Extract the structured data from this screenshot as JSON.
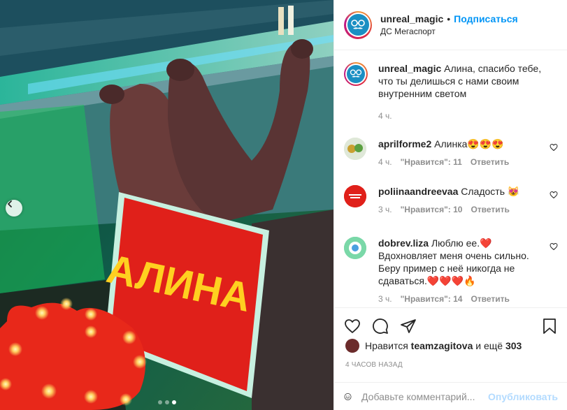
{
  "post": {
    "author": "unreal_magic",
    "separator": "•",
    "follow_label": "Подписаться",
    "location": "ДС Мегаспорт",
    "photo_sign_text": "АЛИНА"
  },
  "caption": {
    "username": "unreal_magic",
    "text": "Алина, спасибо тебе, что ты делишься с нами своим внутренним светом",
    "time": "4 ч."
  },
  "comments": [
    {
      "username": "aprilforme2",
      "text": "Алинка😍😍😍",
      "time": "4 ч.",
      "likes": "\"Нравится\": 11",
      "reply": "Ответить"
    },
    {
      "username": "poliinaandreevaa",
      "text": "Сладость 😻",
      "time": "3 ч.",
      "likes": "\"Нравится\": 10",
      "reply": "Ответить"
    },
    {
      "username": "dobrev.liza",
      "text": "Люблю ее.❤️ Вдохновляет меня очень сильно. Беру пример с неё никогда не сдаваться.❤️❤️❤️🔥",
      "time": "3 ч.",
      "likes": "\"Нравится\": 14",
      "reply": "Ответить"
    }
  ],
  "likes_line": {
    "prefix": "Нравится",
    "user": "teamzagitova",
    "middle": "и ещё",
    "count": "303"
  },
  "time_ago": "4 ЧАСОВ НАЗАД",
  "add_comment": {
    "placeholder": "Добавьте комментарий...",
    "publish": "Опубликовать"
  },
  "icons": {
    "like": "heart-icon",
    "comment": "comment-icon",
    "share": "share-icon",
    "save": "bookmark-icon",
    "emoji": "emoji-icon",
    "prev": "chevron-left-icon"
  },
  "colors": {
    "link": "#0095f6",
    "muted": "#8e8e8e",
    "publish_disabled": "#b3dbff",
    "text": "#262626"
  },
  "carousel": {
    "total": 3,
    "active": 3
  }
}
